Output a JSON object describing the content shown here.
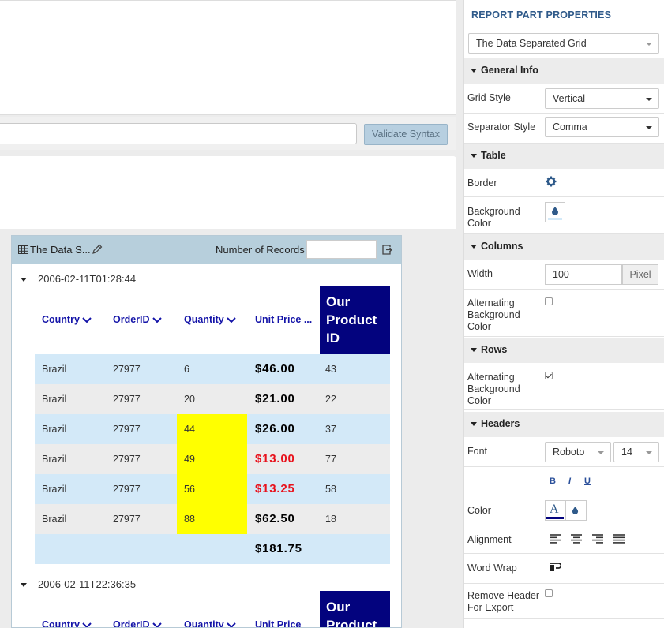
{
  "toolbar": {
    "validate_label": "Validate Syntax"
  },
  "grid": {
    "title": "The Data S...",
    "records_label": "Number of Records",
    "records_value": "",
    "groups": [
      {
        "label": "2006-02-11T01:28:44",
        "headers": {
          "country": "Country",
          "order_id": "OrderID",
          "quantity": "Quantity",
          "unit_price": "Unit Price ...",
          "product_id": "Our Product ID"
        },
        "rows": [
          {
            "country": "Brazil",
            "order_id": "27977",
            "quantity": "6",
            "unit_price": "$46.00",
            "product_id": "43",
            "qty_highlight": false,
            "price_red": false
          },
          {
            "country": "Brazil",
            "order_id": "27977",
            "quantity": "20",
            "unit_price": "$21.00",
            "product_id": "22",
            "qty_highlight": false,
            "price_red": false
          },
          {
            "country": "Brazil",
            "order_id": "27977",
            "quantity": "44",
            "unit_price": "$26.00",
            "product_id": "37",
            "qty_highlight": true,
            "price_red": false
          },
          {
            "country": "Brazil",
            "order_id": "27977",
            "quantity": "49",
            "unit_price": "$13.00",
            "product_id": "77",
            "qty_highlight": true,
            "price_red": true
          },
          {
            "country": "Brazil",
            "order_id": "27977",
            "quantity": "56",
            "unit_price": "$13.25",
            "product_id": "58",
            "qty_highlight": true,
            "price_red": true
          },
          {
            "country": "Brazil",
            "order_id": "27977",
            "quantity": "88",
            "unit_price": "$62.50",
            "product_id": "18",
            "qty_highlight": true,
            "price_red": false
          }
        ],
        "total": "$181.75"
      },
      {
        "label": "2006-02-11T22:36:35",
        "headers": {
          "country": "Country",
          "order_id": "OrderID",
          "quantity": "Quantity",
          "unit_price": "Unit Price",
          "product_id": "Our Product"
        }
      }
    ]
  },
  "props": {
    "title": "REPORT PART PROPERTIES",
    "part_select": "The Data Separated Grid",
    "sections": {
      "general": "General Info",
      "table": "Table",
      "columns": "Columns",
      "rows": "Rows",
      "headers": "Headers"
    },
    "grid_style_label": "Grid Style",
    "grid_style_value": "Vertical",
    "separator_label": "Separator Style",
    "separator_value": "Comma",
    "border_label": "Border",
    "bgcolor_label_1": "Background",
    "bgcolor_label_2": "Color",
    "width_label": "Width",
    "width_value": "100",
    "width_unit": "Pixel",
    "alt_bg_label_1": "Alternating",
    "alt_bg_label_2": "Background",
    "alt_bg_label_3": "Color",
    "columns_alt_checked": false,
    "rows_alt_checked": true,
    "font_label": "Font",
    "font_value": "Roboto",
    "font_size_value": "14",
    "bold_label": "B",
    "italic_label": "I",
    "underline_label": "U",
    "color_label": "Color",
    "text_color_glyph": "A",
    "alignment_label": "Alignment",
    "word_wrap_label": "Word Wrap",
    "remove_header_label_1": "Remove Header",
    "remove_header_label_2": "For Export",
    "remove_header_checked": false
  },
  "colors": {
    "accent": "#2f5a8a",
    "header_blue": "#03037e",
    "highlight": "#ffff00",
    "price_red": "#e8121c",
    "row_blue": "#d3e9f8"
  }
}
